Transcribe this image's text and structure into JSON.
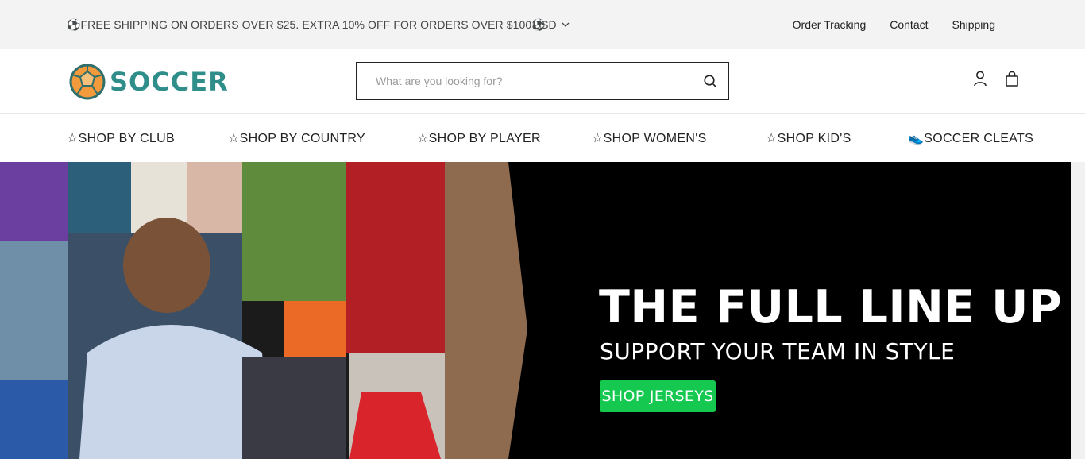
{
  "topbar": {
    "promo": "⚽FREE SHIPPING ON ORDERS OVER $25. EXTRA 10% OFF FOR ORDERS OVER $100⚽",
    "currency": "USD",
    "links": [
      "Order Tracking",
      "Contact",
      "Shipping"
    ]
  },
  "header": {
    "logo_text": "SOCCER",
    "search_placeholder": "What are you looking for?",
    "icons": [
      "search-icon",
      "account-icon",
      "cart-icon"
    ]
  },
  "nav": {
    "items": [
      "☆SHOP BY CLUB",
      "☆SHOP BY COUNTRY",
      "☆SHOP BY PLAYER",
      "☆SHOP WOMEN'S",
      "☆SHOP KID'S",
      "👟SOCCER CLEATS"
    ]
  },
  "hero": {
    "headline": "THE FULL LINE UP",
    "subheadline": "SUPPORT YOUR TEAM IN STYLE",
    "cta": "SHOP JERSEYS",
    "cta_color": "#14c850",
    "background": "#000000"
  },
  "colors": {
    "topbar_bg": "#f3f3f3",
    "brand_teal": "#2f8e8a",
    "brand_orange": "#f39a3c"
  }
}
